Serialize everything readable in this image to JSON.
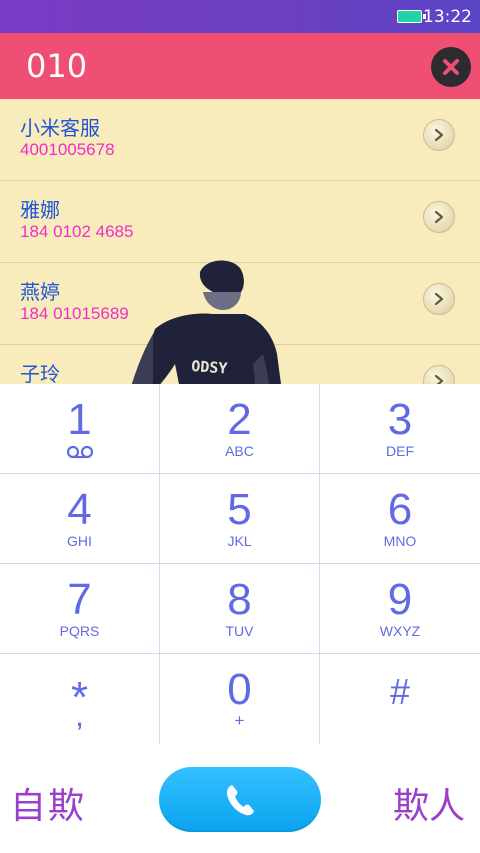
{
  "status_bar": {
    "time": "13:22"
  },
  "dial_input": {
    "number": "010"
  },
  "contacts": [
    {
      "name": "小米客服",
      "number": "4001005678"
    },
    {
      "name": "雅娜",
      "number": "184 0102 4685"
    },
    {
      "name": "燕婷",
      "number": "184 01015689"
    },
    {
      "name": "子玲",
      "number": ""
    }
  ],
  "keypad": [
    {
      "digit": "1",
      "letters": ""
    },
    {
      "digit": "2",
      "letters": "ABC"
    },
    {
      "digit": "3",
      "letters": "DEF"
    },
    {
      "digit": "4",
      "letters": "GHI"
    },
    {
      "digit": "5",
      "letters": "JKL"
    },
    {
      "digit": "6",
      "letters": "MNO"
    },
    {
      "digit": "7",
      "letters": "PQRS"
    },
    {
      "digit": "8",
      "letters": "TUV"
    },
    {
      "digit": "9",
      "letters": "WXYZ"
    },
    {
      "digit": "*",
      "letters": ","
    },
    {
      "digit": "0",
      "letters": "+"
    },
    {
      "digit": "#",
      "letters": ""
    }
  ],
  "bottom_bar": {
    "left_label": "自欺",
    "right_label": "欺人"
  },
  "icons": {
    "clear": "close-icon",
    "contact_detail": "chevron-right-icon",
    "voicemail": "voicemail-icon",
    "call": "phone-icon",
    "battery": "battery-icon"
  },
  "colors": {
    "status_bar": "#6a3fc0",
    "input_bar": "#ee4f73",
    "contact_bg": "#f8ecbc",
    "contact_name": "#2355d8",
    "contact_number": "#f02fc6",
    "keypad_text": "#6169e5",
    "call_button": "#1ab0f5",
    "bottom_labels": "#9b3fc9"
  }
}
